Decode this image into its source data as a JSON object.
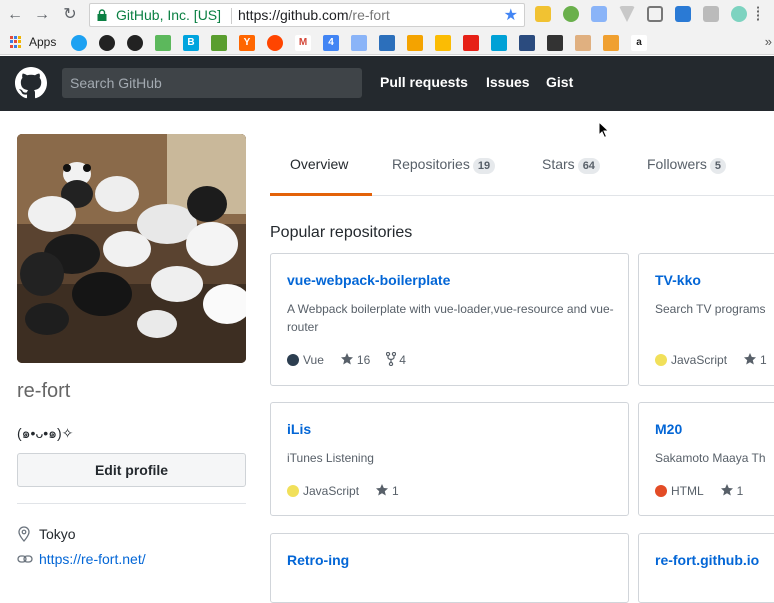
{
  "browser": {
    "org_label": "GitHub, Inc. [US]",
    "url_host": "https://github.com",
    "url_path": "/re-fort",
    "back_glyph": "←",
    "forward_glyph": "→",
    "reload_glyph": "↻",
    "star_glyph": "★"
  },
  "bookmarks": {
    "apps_label": "Apps",
    "more_glyph": "»"
  },
  "header": {
    "search_placeholder": "Search GitHub",
    "nav": [
      "Pull requests",
      "Issues",
      "Gist"
    ]
  },
  "profile": {
    "username": "re-fort",
    "bio": "(๑•ᴗ•๑)✧",
    "edit_label": "Edit profile",
    "location": "Tokyo",
    "website": "https://re-fort.net/"
  },
  "tabs": [
    {
      "label": "Overview",
      "count": ""
    },
    {
      "label": "Repositories",
      "count": "19"
    },
    {
      "label": "Stars",
      "count": "64"
    },
    {
      "label": "Followers",
      "count": "5"
    }
  ],
  "popular_title": "Popular repositories",
  "repos": [
    {
      "name": "vue-webpack-boilerplate",
      "description": "A Webpack boilerplate with vue-loader,vue-resource and vue-router",
      "language": "Vue",
      "lang_color": "#2c3e50",
      "stars": "16",
      "forks": "4"
    },
    {
      "name": "TV-kko",
      "description": "Search TV programs",
      "language": "JavaScript",
      "lang_color": "#f1e05a",
      "stars": "1",
      "forks": ""
    },
    {
      "name": "iLis",
      "description": "iTunes Listening",
      "language": "JavaScript",
      "lang_color": "#f1e05a",
      "stars": "1",
      "forks": ""
    },
    {
      "name": "M20",
      "description": "Sakamoto Maaya Th",
      "language": "HTML",
      "lang_color": "#e34c26",
      "stars": "1",
      "forks": ""
    },
    {
      "name": "Retro-ing",
      "description": "",
      "language": "",
      "lang_color": "",
      "stars": "",
      "forks": ""
    },
    {
      "name": "re-fort.github.io",
      "description": "",
      "language": "",
      "lang_color": "",
      "stars": "",
      "forks": ""
    }
  ]
}
